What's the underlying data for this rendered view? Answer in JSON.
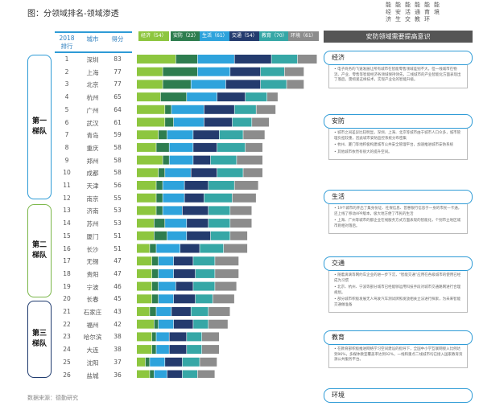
{
  "title": "图：分领域排名-领域渗透",
  "top_labels": [
    "能经济",
    "能安生",
    "能活交",
    "能通教",
    "能育环",
    "能境"
  ],
  "columns": {
    "rank_l1": "2018",
    "rank_l2": "排行",
    "city": "城市",
    "score": "得分"
  },
  "tiers": [
    {
      "label": "第一梯队",
      "class": ""
    },
    {
      "label": "第二梯队",
      "class": "g"
    },
    {
      "label": "第三梯队",
      "class": "n"
    }
  ],
  "legend": [
    "经济（54）",
    "安防（22）",
    "生活（61）",
    "交通（54）",
    "教育（70）",
    "环境（61）"
  ],
  "colors": [
    "#8dc63f",
    "#2e7d4f",
    "#2ea3dc",
    "#243b6e",
    "#36a7a6",
    "#8c8c8c"
  ],
  "chart_data": {
    "type": "bar",
    "stacked": true,
    "orientation": "horizontal",
    "title": "图：分领域排名-领域渗透",
    "series_names": [
      "经济",
      "安防",
      "生活",
      "交通",
      "教育",
      "环境"
    ],
    "rows": [
      {
        "rank": "1",
        "city": "深圳",
        "score": "83",
        "parts": [
          18,
          10,
          17,
          17,
          12,
          9
        ]
      },
      {
        "rank": "2",
        "city": "上海",
        "score": "77",
        "parts": [
          12,
          16,
          15,
          14,
          11,
          9
        ]
      },
      {
        "rank": "3",
        "city": "北京",
        "77": "",
        "score": "77",
        "parts": [
          12,
          13,
          16,
          16,
          12,
          8
        ]
      },
      {
        "rank": "4",
        "city": "杭州",
        "score": "65",
        "parts": [
          11,
          12,
          14,
          13,
          10,
          5
        ]
      },
      {
        "rank": "5",
        "city": "广州",
        "score": "64",
        "parts": [
          13,
          3,
          15,
          14,
          10,
          9
        ]
      },
      {
        "rank": "6",
        "city": "武汉",
        "score": "61",
        "parts": [
          13,
          4,
          14,
          13,
          9,
          8
        ]
      },
      {
        "rank": "7",
        "city": "青岛",
        "score": "59",
        "parts": [
          10,
          4,
          12,
          12,
          11,
          10
        ]
      },
      {
        "rank": "8",
        "city": "重庆",
        "score": "58",
        "parts": [
          9,
          6,
          11,
          11,
          13,
          8
        ]
      },
      {
        "rank": "9",
        "city": "郑州",
        "score": "58",
        "parts": [
          12,
          3,
          11,
          8,
          12,
          12
        ]
      },
      {
        "rank": "10",
        "city": "成都",
        "score": "58",
        "parts": [
          10,
          3,
          12,
          12,
          12,
          9
        ]
      },
      {
        "rank": "11",
        "city": "天津",
        "score": "56",
        "parts": [
          9,
          3,
          10,
          11,
          12,
          11
        ]
      },
      {
        "rank": "12",
        "city": "南京",
        "score": "55",
        "parts": [
          9,
          3,
          10,
          9,
          13,
          11
        ]
      },
      {
        "rank": "13",
        "city": "济南",
        "score": "53",
        "parts": [
          9,
          3,
          9,
          12,
          10,
          10
        ]
      },
      {
        "rank": "14",
        "city": "苏州",
        "score": "53",
        "parts": [
          8,
          5,
          10,
          10,
          10,
          10
        ]
      },
      {
        "rank": "15",
        "city": "厦门",
        "score": "51",
        "parts": [
          8,
          6,
          9,
          11,
          9,
          8
        ]
      },
      {
        "rank": "16",
        "city": "长沙",
        "score": "51",
        "parts": [
          6,
          3,
          11,
          9,
          11,
          11
        ]
      },
      {
        "rank": "17",
        "city": "无锡",
        "score": "47",
        "parts": [
          7,
          3,
          7,
          9,
          10,
          11
        ]
      },
      {
        "rank": "18",
        "city": "贵阳",
        "score": "47",
        "parts": [
          7,
          3,
          7,
          10,
          9,
          11
        ]
      },
      {
        "rank": "19",
        "city": "宁波",
        "score": "46",
        "parts": [
          7,
          3,
          8,
          8,
          10,
          10
        ]
      },
      {
        "rank": "20",
        "city": "长春",
        "score": "45",
        "parts": [
          7,
          3,
          7,
          10,
          8,
          10
        ]
      },
      {
        "rank": "21",
        "city": "石家庄",
        "score": "43",
        "parts": [
          6,
          3,
          7,
          9,
          8,
          10
        ]
      },
      {
        "rank": "22",
        "city": "福州",
        "score": "42",
        "parts": [
          8,
          2,
          7,
          9,
          7,
          9
        ]
      },
      {
        "rank": "23",
        "city": "哈尔滨",
        "score": "38",
        "parts": [
          7,
          2,
          6,
          8,
          7,
          8
        ]
      },
      {
        "rank": "24",
        "city": "大连",
        "score": "38",
        "parts": [
          7,
          2,
          6,
          8,
          7,
          8
        ]
      },
      {
        "rank": "25",
        "city": "沈阳",
        "score": "37",
        "parts": [
          4,
          2,
          7,
          8,
          8,
          8
        ]
      },
      {
        "rank": "26",
        "city": "盐城",
        "score": "36",
        "parts": [
          6,
          2,
          6,
          7,
          7,
          8
        ]
      }
    ]
  },
  "panel": {
    "heading": "安防领域需要提高意识",
    "sections": [
      {
        "title": "经济",
        "items": [
          "电子商务的飞速发展让所有城市在智能零售领域差别不大，但一线城市在物流、产业、零售等智能经济各领域保持领先，二线城市的产业智能化方面表现出了落后，需抓紧这样技术，实现产业化的智能升级。"
        ]
      },
      {
        "title": "安防",
        "items": [
          "城市之间差异比较明显，深圳、上海、北京等城市由于城市人口众多，城市管理负担较重，因此城市安防监控系统分布密集",
          "杭州、厦门等地积极构建城市公共安全管理平台，加速推进城市安防系统",
          "其他城市依然有很大的提升空间。"
        ]
      },
      {
        "title": "生活",
        "items": [
          "19个城市的开启了集身份证、社保信息、普惠银行信息于一身的市民一卡通，还上线了移动APP版本，极大地方便了市民的生活",
          "上海、广州等城市的都企业在线服务方式方面表现的智能化，个别市立地区城市则相对落后。"
        ]
      },
      {
        "title": "交通",
        "items": [
          "随着滴滴等网约车企业的进一步下沉，“智能交通”应用在各级城市的使用已经成为习惯",
          "北京、杭州、宁波等部分城市已经能够运用科技手段对城市交通路网进行合理规划。",
          "部分城市积极发展无人驾驶汽车测试牌照发放相关立法进行探索，为未来智能交通做准备"
        ]
      },
      {
        "title": "教育",
        "items": [
          "在教育部积极推进网络学习空间建设的指导下，全国中小学互联网接入比例达到96%，多媒体教室覆盖率达到92%，一线和重点二线城市均已接入国家教育资源公共服务平台。"
        ]
      },
      {
        "title": "环境",
        "items": []
      }
    ]
  },
  "source": "数据来源：德勤研究"
}
